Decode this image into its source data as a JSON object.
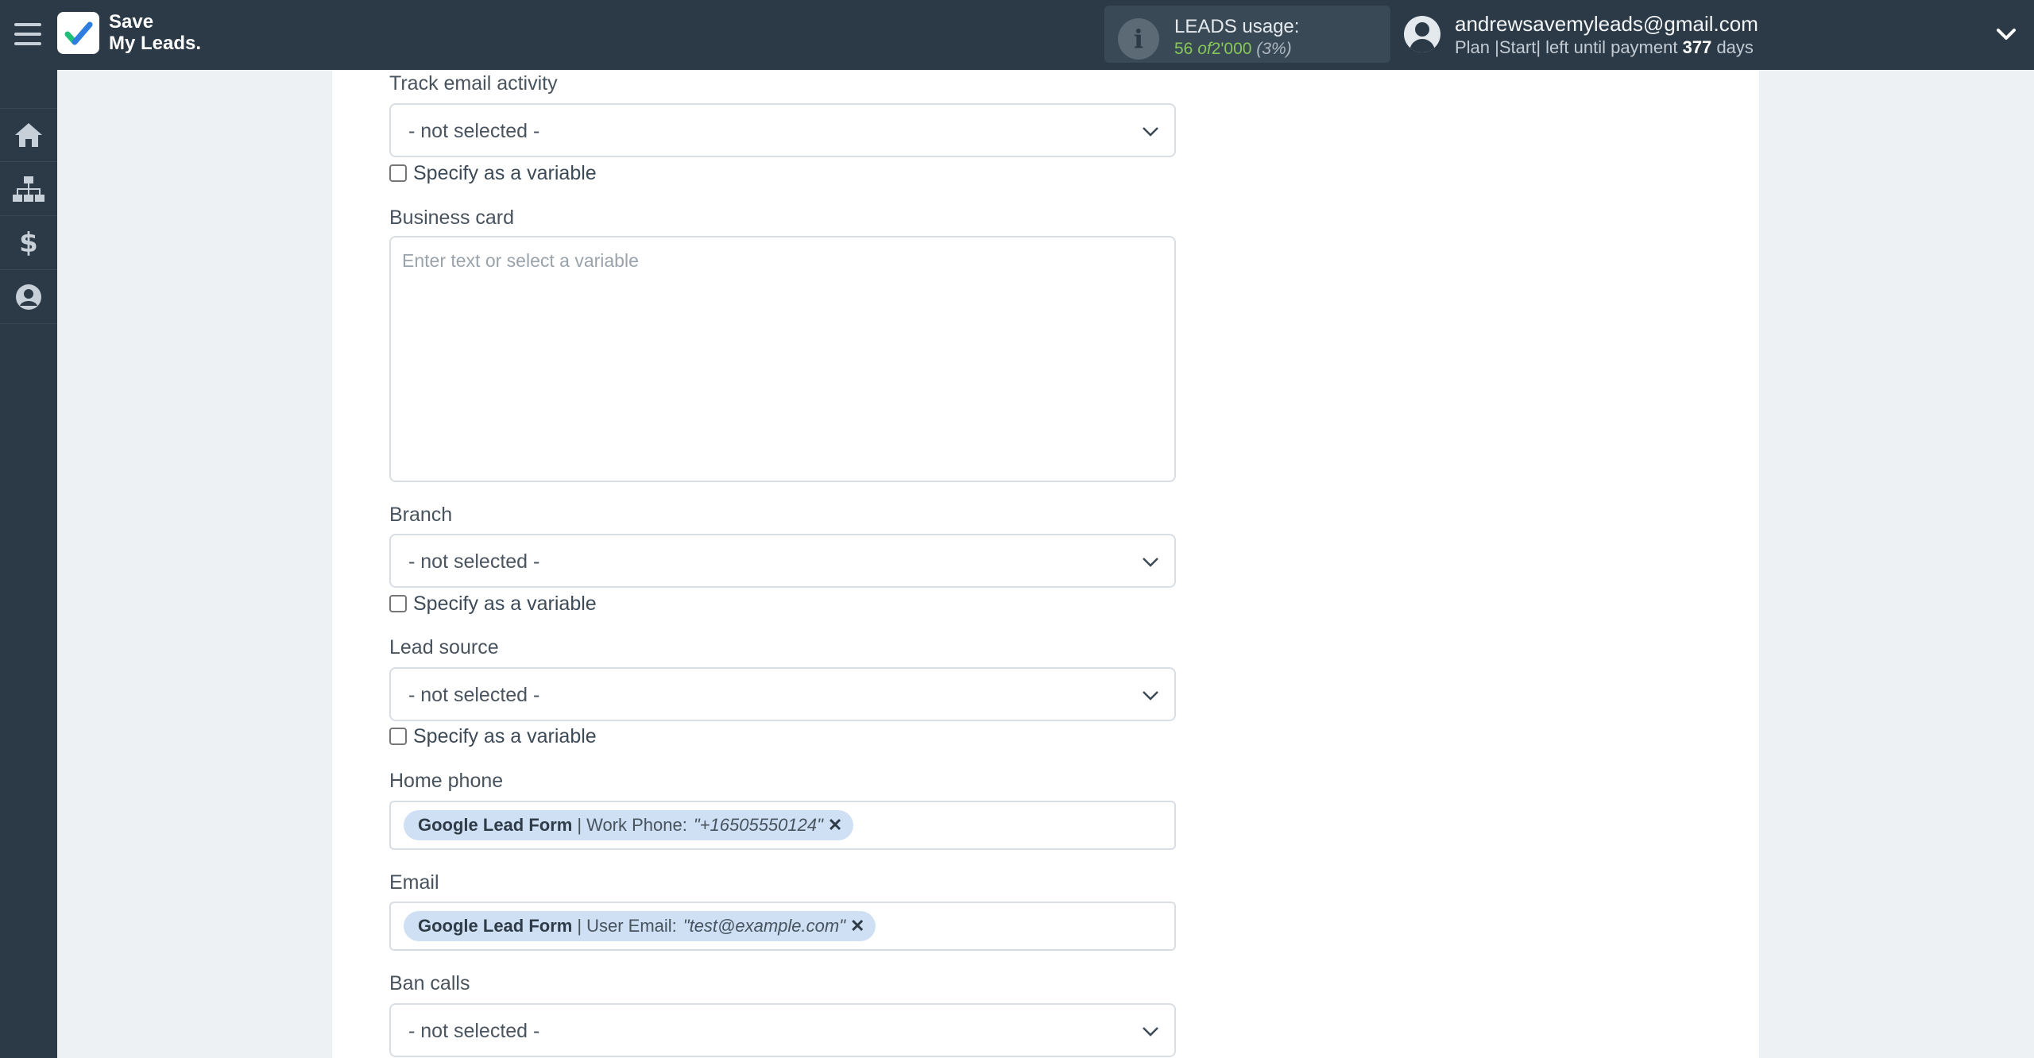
{
  "header": {
    "logo_line1": "Save",
    "logo_line2": "My Leads.",
    "usage_title": "LEADS usage:",
    "usage_used": "56",
    "usage_of": "of",
    "usage_total": "2'000",
    "usage_percent": "(3%)",
    "email": "andrewsavemyleads@gmail.com",
    "plan_prefix": "Plan |Start| left until payment",
    "plan_days": "377",
    "plan_suffix": "days"
  },
  "sidebar": {
    "items": [
      {
        "icon": "home-icon"
      },
      {
        "icon": "sitemap-icon"
      },
      {
        "icon": "dollar-icon"
      },
      {
        "icon": "user-circle-icon"
      }
    ]
  },
  "form": {
    "track_email": {
      "label": "Track email activity",
      "value": "- not selected -",
      "checkbox": "Specify as a variable"
    },
    "business_card": {
      "label": "Business card",
      "placeholder": "Enter text or select a variable"
    },
    "branch": {
      "label": "Branch",
      "value": "- not selected -",
      "checkbox": "Specify as a variable"
    },
    "lead_source": {
      "label": "Lead source",
      "value": "- not selected -",
      "checkbox": "Specify as a variable"
    },
    "home_phone": {
      "label": "Home phone",
      "tag_source": "Google Lead Form",
      "tag_sep": "|",
      "tag_field": "Work Phone:",
      "tag_value": "\"+16505550124\""
    },
    "email": {
      "label": "Email",
      "tag_source": "Google Lead Form",
      "tag_sep": "|",
      "tag_field": "User Email:",
      "tag_value": "\"test@example.com\""
    },
    "ban_calls": {
      "label": "Ban calls",
      "value": "- not selected -"
    }
  },
  "colors": {
    "topbar": "#2c3a47",
    "tag_bg": "#cfe0f5",
    "usage_green": "#86c75a"
  }
}
